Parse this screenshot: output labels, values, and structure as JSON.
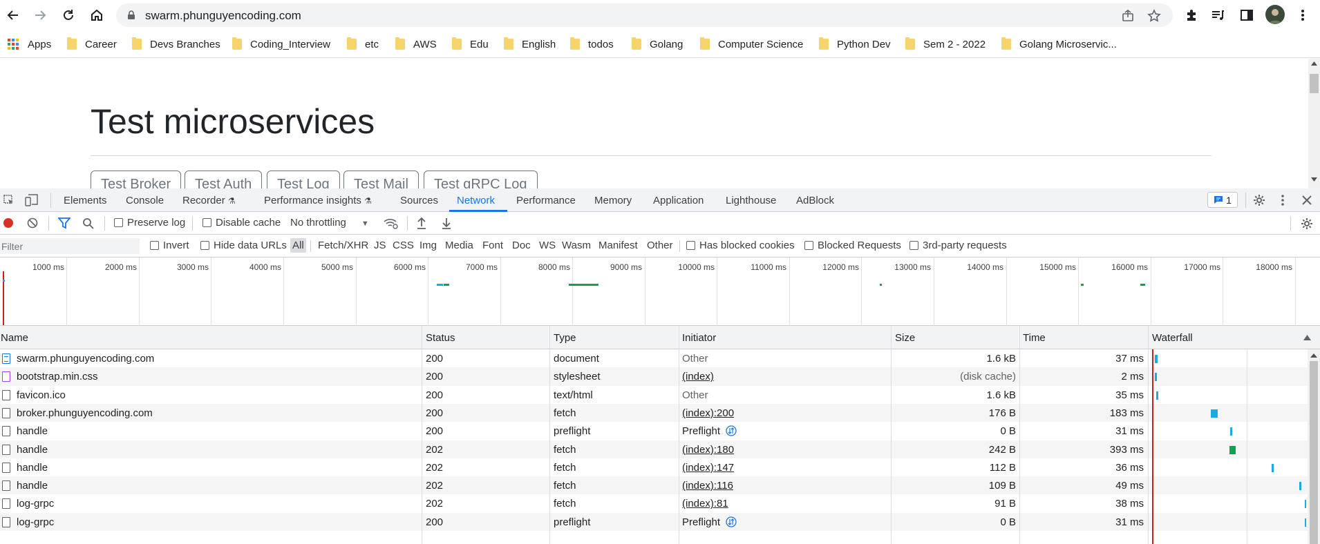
{
  "browser": {
    "url": "swarm.phunguyencoding.com"
  },
  "bookmarks": [
    {
      "label": "Apps"
    },
    {
      "label": "Career"
    },
    {
      "label": "Devs Branches"
    },
    {
      "label": "Coding_Interview"
    },
    {
      "label": "etc"
    },
    {
      "label": "AWS"
    },
    {
      "label": "Edu"
    },
    {
      "label": "English"
    },
    {
      "label": "todos"
    },
    {
      "label": "Golang"
    },
    {
      "label": "Computer Science"
    },
    {
      "label": "Python Dev"
    },
    {
      "label": "Sem 2 - 2022"
    },
    {
      "label": "Golang Microservic..."
    }
  ],
  "page": {
    "title": "Test microservices",
    "buttons": [
      "Test Broker",
      "Test Auth",
      "Test Log",
      "Test Mail",
      "Test gRPC Log"
    ]
  },
  "devtools": {
    "tabs": [
      "Elements",
      "Console",
      "Recorder",
      "Performance insights",
      "Sources",
      "Network",
      "Performance",
      "Memory",
      "Application",
      "Lighthouse",
      "AdBlock"
    ],
    "active_tab": "Network",
    "issues_count": "1",
    "toolbar": {
      "preserve_log": "Preserve log",
      "disable_cache": "Disable cache",
      "throttling": "No throttling"
    },
    "filterbar": {
      "placeholder": "Filter",
      "invert": "Invert",
      "hide_data_urls": "Hide data URLs",
      "types": [
        "All",
        "Fetch/XHR",
        "JS",
        "CSS",
        "Img",
        "Media",
        "Font",
        "Doc",
        "WS",
        "Wasm",
        "Manifest",
        "Other"
      ],
      "has_blocked_cookies": "Has blocked cookies",
      "blocked_requests": "Blocked Requests",
      "third_party": "3rd-party requests"
    },
    "overview_ticks": [
      "1000 ms",
      "2000 ms",
      "3000 ms",
      "4000 ms",
      "5000 ms",
      "6000 ms",
      "7000 ms",
      "8000 ms",
      "9000 ms",
      "10000 ms",
      "11000 ms",
      "12000 ms",
      "13000 ms",
      "14000 ms",
      "15000 ms",
      "16000 ms",
      "17000 ms",
      "18000 ms"
    ],
    "columns": [
      "Name",
      "Status",
      "Type",
      "Initiator",
      "Size",
      "Time",
      "Waterfall"
    ],
    "rows": [
      {
        "name": "swarm.phunguyencoding.com",
        "icon": "document",
        "status": "200",
        "type": "document",
        "initiator": "Other",
        "initiator_link": false,
        "size": "1.6 kB",
        "time": "37 ms"
      },
      {
        "name": "bootstrap.min.css",
        "icon": "stylesheet",
        "status": "200",
        "type": "stylesheet",
        "initiator": "(index)",
        "initiator_link": true,
        "size": "(disk cache)",
        "time": "2 ms"
      },
      {
        "name": "favicon.ico",
        "icon": "file",
        "status": "200",
        "type": "text/html",
        "initiator": "Other",
        "initiator_link": false,
        "size": "1.6 kB",
        "time": "35 ms"
      },
      {
        "name": "broker.phunguyencoding.com",
        "icon": "file",
        "status": "200",
        "type": "fetch",
        "initiator": "(index):200",
        "initiator_link": true,
        "size": "176 B",
        "time": "183 ms"
      },
      {
        "name": "handle",
        "icon": "file",
        "status": "200",
        "type": "preflight",
        "initiator": "Preflight",
        "initiator_link": false,
        "preflight": true,
        "size": "0 B",
        "time": "31 ms"
      },
      {
        "name": "handle",
        "icon": "file",
        "status": "202",
        "type": "fetch",
        "initiator": "(index):180",
        "initiator_link": true,
        "size": "242 B",
        "time": "393 ms"
      },
      {
        "name": "handle",
        "icon": "file",
        "status": "202",
        "type": "fetch",
        "initiator": "(index):147",
        "initiator_link": true,
        "size": "112 B",
        "time": "36 ms"
      },
      {
        "name": "handle",
        "icon": "file",
        "status": "202",
        "type": "fetch",
        "initiator": "(index):116",
        "initiator_link": true,
        "size": "109 B",
        "time": "49 ms"
      },
      {
        "name": "log-grpc",
        "icon": "file",
        "status": "202",
        "type": "fetch",
        "initiator": "(index):81",
        "initiator_link": true,
        "size": "91 B",
        "time": "38 ms"
      },
      {
        "name": "log-grpc",
        "icon": "file",
        "status": "200",
        "type": "preflight",
        "initiator": "Preflight",
        "initiator_link": false,
        "preflight": true,
        "size": "0 B",
        "time": "31 ms"
      }
    ],
    "colors": {
      "accent": "#1a73e8",
      "record": "#d93025",
      "waterfall_blue": "#1ea9e1",
      "waterfall_green": "#12a150"
    }
  }
}
